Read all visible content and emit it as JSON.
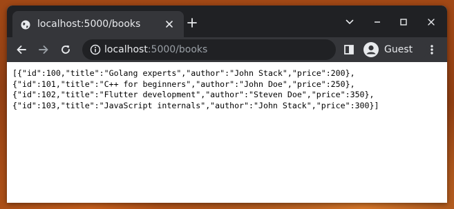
{
  "browser": {
    "tab": {
      "title": "localhost:5000/books",
      "favicon": "globe-icon"
    },
    "omnibox": {
      "host": "localhost",
      "path": ":5000/books"
    },
    "profile": {
      "label": "Guest"
    },
    "colors": {
      "titlebar": "#202124",
      "toolbar": "#35363a",
      "text": "#e8eaed"
    }
  },
  "page": {
    "json_lines": [
      "[{\"id\":100,\"title\":\"Golang experts\",\"author\":\"John Stack\",\"price\":200},",
      "{\"id\":101,\"title\":\"C++ for beginners\",\"author\":\"John Doe\",\"price\":250},",
      "{\"id\":102,\"title\":\"Flutter development\",\"author\":\"Steven Doe\",\"price\":350},",
      "{\"id\":103,\"title\":\"JavaScript internals\",\"author\":\"John Stack\",\"price\":300}]"
    ]
  }
}
